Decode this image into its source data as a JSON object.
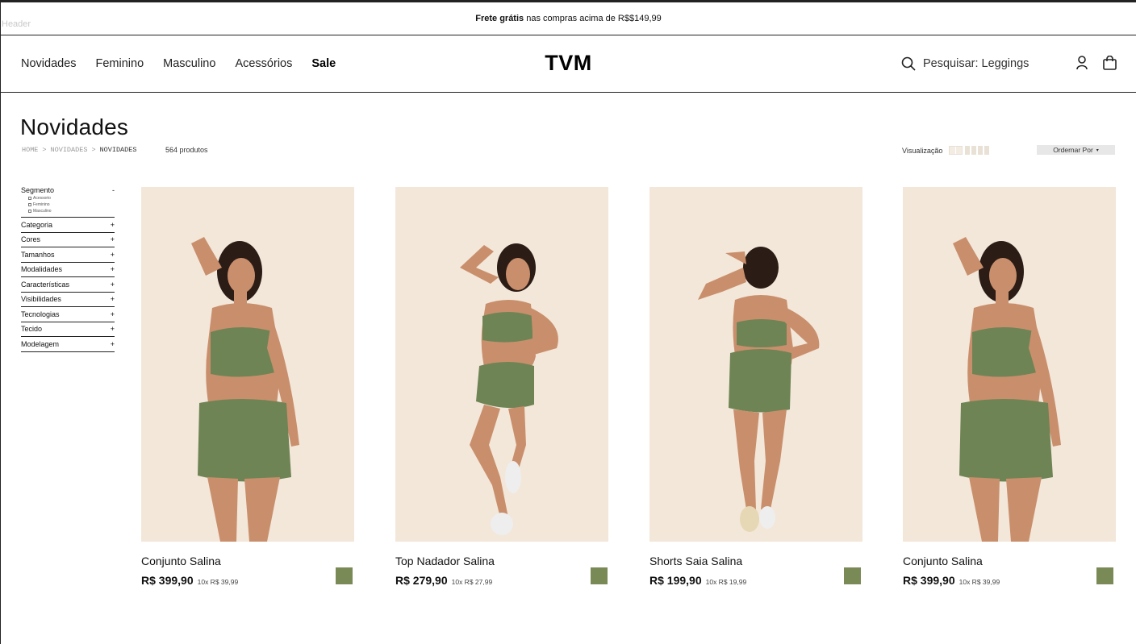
{
  "frame_label": "Header",
  "promo": {
    "bold": "Frete grátis",
    "rest": " nas compras acima de R$$149,99"
  },
  "nav": {
    "items": [
      "Novidades",
      "Feminino",
      "Masculino",
      "Acessórios"
    ],
    "sale": "Sale"
  },
  "brand": "TVM",
  "search": {
    "text": "Pesquisar: Leggings",
    "icon": "search-icon"
  },
  "header_icons": [
    "user-icon",
    "bag-icon"
  ],
  "page": {
    "title": "Novidades",
    "breadcrumb": [
      "HOME",
      ">",
      "NOVIDADES",
      ">",
      "NOVIDADES"
    ],
    "count": "564 produtos",
    "view_label": "Visualização",
    "sort_label": "Ordernar Por",
    "sort_caret": "▾"
  },
  "filters": {
    "segment": {
      "label": "Segmento",
      "toggle": "-",
      "options": [
        "Acessorio",
        "Feminino",
        "Masculino"
      ]
    },
    "groups": [
      "Categoria",
      "Cores",
      "Tamanhos",
      "Modalidades",
      "Características",
      "Visibilidades",
      "Tecnologias",
      "Tecido",
      "Modelagem"
    ],
    "group_toggle": "+"
  },
  "products": [
    {
      "name": "Conjunto Salina",
      "price": "R$ 399,90",
      "installments": "10x R$ 39,99",
      "swatch": "#7a8a57"
    },
    {
      "name": "Top Nadador Salina",
      "price": "R$ 279,90",
      "installments": "10x R$ 27,99",
      "swatch": "#7a8a57"
    },
    {
      "name": "Shorts Saia Salina",
      "price": "R$ 199,90",
      "installments": "10x R$ 19,99",
      "swatch": "#7a8a57"
    },
    {
      "name": "Conjunto Salina",
      "price": "R$ 399,90",
      "installments": "10x R$ 39,99",
      "swatch": "#7a8a57"
    }
  ],
  "colors": {
    "image_bg": "#f3e7da",
    "outfit_green": "#6f8455",
    "skin": "#c98f6c",
    "hair": "#2c1c16"
  }
}
